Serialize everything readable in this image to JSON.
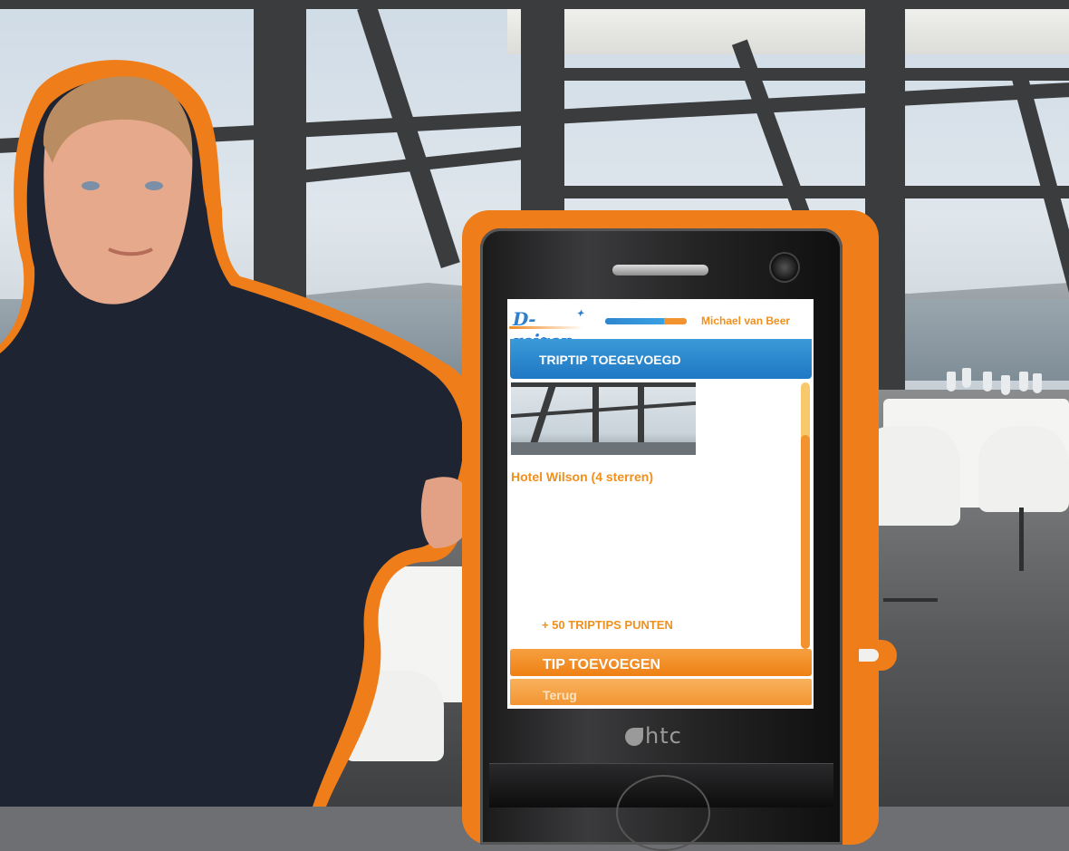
{
  "app": {
    "logo_text": "D-reizen",
    "user_name": "Michael van Beer",
    "progress_fraction": 0.72,
    "progress_secondary_fraction": 0.28
  },
  "header": {
    "title": "TRIPTIP TOEGEVOEGD"
  },
  "content": {
    "hotel_name": "Hotel Wilson (4 sterren)",
    "points_text": "+ 50 TRIPTIPS PUNTEN",
    "scroll_position": 0.2
  },
  "buttons": {
    "add_tip": "TIP TOEVOEGEN",
    "back": "Terug"
  },
  "device": {
    "brand": "htc"
  },
  "colors": {
    "accent_orange": "#ef7d1a",
    "header_blue": "#1f78c4",
    "brand_blue": "#2f7fcb",
    "text_orange": "#f0901d"
  },
  "icons": [
    "htc-logo-icon",
    "camera-icon",
    "speaker-icon",
    "star-icon"
  ]
}
